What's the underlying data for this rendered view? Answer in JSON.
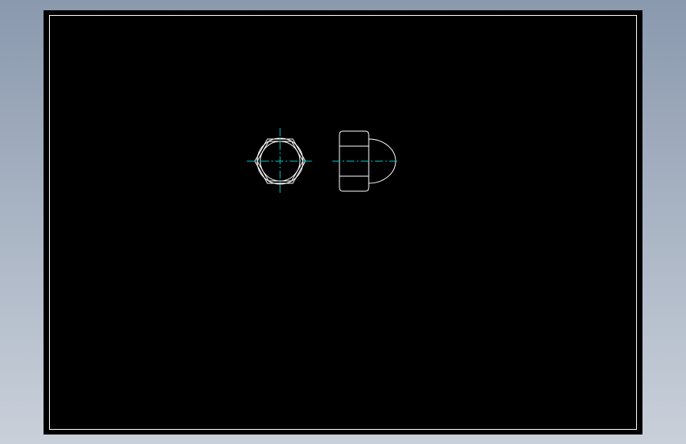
{
  "viewport": {
    "background_top": "#8a99ae",
    "background_bottom": "#c9d0da"
  },
  "sheet": {
    "background": "#000000",
    "border_color": "#ffffff"
  },
  "colors": {
    "outline": "#ffffff",
    "centerline": "#00c8c8"
  },
  "views": [
    {
      "name": "top-view",
      "shape": "hexagon-with-circle"
    },
    {
      "name": "side-view",
      "shape": "hex-body-with-dome"
    }
  ]
}
